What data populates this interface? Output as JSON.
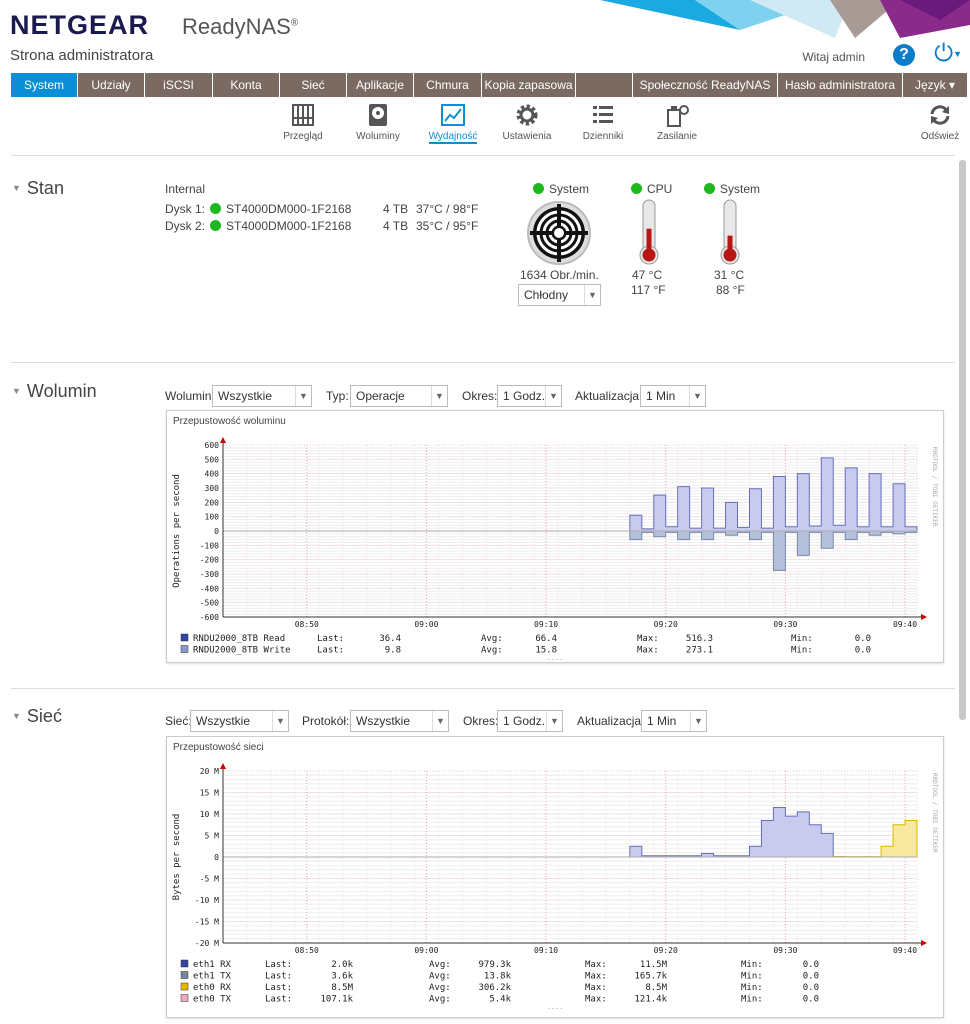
{
  "header": {
    "brand": "NETGEAR",
    "product": "ReadyNAS",
    "product_mark": "®",
    "subtitle": "Strona administratora",
    "welcome": "Witaj admin",
    "help_glyph": "?",
    "power_glyph": "⏻",
    "icons": [
      "help-icon",
      "power-icon"
    ]
  },
  "nav": [
    {
      "label": "System",
      "active": true
    },
    {
      "label": "Udziały"
    },
    {
      "label": "iSCSI"
    },
    {
      "label": "Konta"
    },
    {
      "label": "Sieć"
    },
    {
      "label": "Aplikacje"
    },
    {
      "label": "Chmura"
    },
    {
      "label": "Kopia zapasowa"
    },
    {
      "label": ""
    },
    {
      "label": "Społeczność ReadyNAS"
    },
    {
      "label": "Hasło administratora"
    },
    {
      "label": "Język ▾"
    }
  ],
  "toolbar": {
    "overview": "Przegląd",
    "volumes": "Woluminy",
    "performance": "Wydajność",
    "settings": "Ustawienia",
    "logs": "Dzienniki",
    "power": "Zasilanie",
    "refresh": "Odśwież"
  },
  "stan": {
    "title": "Stan",
    "group": "Internal",
    "disks": [
      {
        "label": "Dysk 1:",
        "model": "ST4000DM000-1F2168",
        "size": "4 TB",
        "temp": "37°C / 98°F"
      },
      {
        "label": "Dysk 2:",
        "model": "ST4000DM000-1F2168",
        "size": "4 TB",
        "temp": "35°C / 95°F"
      }
    ],
    "fan": {
      "label": "System",
      "rpm": "1634 Obr./min.",
      "mode": "Chłodny"
    },
    "cpu": {
      "label": "CPU",
      "c": "47 °C",
      "f": "117 °F",
      "level": 0.55
    },
    "sys": {
      "label": "System",
      "c": "31 °C",
      "f": "88 °F",
      "level": 0.4
    }
  },
  "wolumin": {
    "title": "Wolumin",
    "filters": {
      "volume_label": "Wolumin:",
      "volume": "Wszystkie",
      "type_label": "Typ:",
      "type": "Operacje",
      "period_label": "Okres:",
      "period": "1 Godz.",
      "update_label": "Aktualizacja:",
      "update": "1 Min"
    },
    "legend": [
      {
        "name": "RNDU2000_8TB Read",
        "color": "#3344aa",
        "last": "36.4",
        "avg": "66.4",
        "max": "516.3",
        "min": "0.0"
      },
      {
        "name": "RNDU2000_8TB Write",
        "color": "#8899cc",
        "last": "9.8",
        "avg": "15.8",
        "max": "273.1",
        "min": "0.0"
      }
    ]
  },
  "siec": {
    "title": "Sieć",
    "filters": {
      "net_label": "Sieć:",
      "net": "Wszystkie",
      "proto_label": "Protokół:",
      "proto": "Wszystkie",
      "period_label": "Okres:",
      "period": "1 Godz.",
      "update_label": "Aktualizacja:",
      "update": "1 Min"
    },
    "legend": [
      {
        "name": "eth1 RX",
        "color": "#3344aa",
        "last": "2.0k",
        "avg": "979.3k",
        "max": "11.5M",
        "min": "0.0"
      },
      {
        "name": "eth1 TX",
        "color": "#778899",
        "last": "3.6k",
        "avg": "13.8k",
        "max": "165.7k",
        "min": "0.0"
      },
      {
        "name": "eth0 RX",
        "color": "#e8b800",
        "last": "8.5M",
        "avg": "306.2k",
        "max": "8.5M",
        "min": "0.0"
      },
      {
        "name": "eth0 TX",
        "color": "#f2a8c0",
        "last": "107.1k",
        "avg": "5.4k",
        "max": "121.4k",
        "min": "0.0"
      }
    ]
  },
  "legend_labels": {
    "last": "Last:",
    "avg": "Avg:",
    "max": "Max:",
    "min": "Min:"
  },
  "chart_data": [
    {
      "type": "bar",
      "title": "Przepustowość woluminu",
      "ylabel": "Operations per second",
      "xlabel": "",
      "watermark": "RRDTOOL / TOBI OETIKER",
      "ylim": [
        -600,
        600
      ],
      "yticks": [
        "600",
        "500",
        "400",
        "300",
        "200",
        "100",
        "0",
        "-100",
        "-200",
        "-300",
        "-400",
        "-500",
        "-600"
      ],
      "xticks": [
        {
          "t": 50,
          "label": "08:50"
        },
        {
          "t": 60,
          "label": "09:00"
        },
        {
          "t": 70,
          "label": "09:10"
        },
        {
          "t": 80,
          "label": "09:20"
        },
        {
          "t": 90,
          "label": "09:30"
        },
        {
          "t": 100,
          "label": "09:40"
        }
      ],
      "x_range": [
        43,
        101
      ],
      "series": [
        {
          "name": "RNDU2000_8TB Read",
          "x": [
            77,
            78,
            79,
            80,
            81,
            82,
            83,
            84,
            85,
            86,
            87,
            88,
            89,
            90,
            91,
            92,
            93,
            94,
            95,
            96,
            97,
            98,
            99,
            100
          ],
          "values": [
            110,
            15,
            250,
            30,
            310,
            20,
            300,
            20,
            200,
            25,
            295,
            20,
            380,
            30,
            400,
            35,
            510,
            40,
            440,
            30,
            400,
            30,
            330,
            30
          ]
        },
        {
          "name": "RNDU2000_8TB Write",
          "x": [
            77,
            78,
            79,
            80,
            81,
            82,
            83,
            84,
            85,
            86,
            87,
            88,
            89,
            90,
            91,
            92,
            93,
            94,
            95,
            96,
            97,
            98,
            99,
            100
          ],
          "values": [
            -60,
            -10,
            -40,
            -10,
            -60,
            -10,
            -60,
            -10,
            -30,
            -10,
            -60,
            -10,
            -275,
            -10,
            -170,
            -10,
            -120,
            -10,
            -60,
            -10,
            -30,
            -10,
            -20,
            -10
          ]
        }
      ]
    },
    {
      "type": "area",
      "title": "Przepustowość sieci",
      "ylabel": "Bytes per second",
      "xlabel": "",
      "watermark": "RRDTOOL / TOBI OETIKER",
      "ylim": [
        -20,
        20
      ],
      "yticks": [
        "20 M",
        "15 M",
        "10 M",
        "5 M",
        "0",
        "-5 M",
        "-10 M",
        "-15 M",
        "-20 M"
      ],
      "xticks": [
        {
          "t": 50,
          "label": "08:50"
        },
        {
          "t": 60,
          "label": "09:00"
        },
        {
          "t": 70,
          "label": "09:10"
        },
        {
          "t": 80,
          "label": "09:20"
        },
        {
          "t": 90,
          "label": "09:30"
        },
        {
          "t": 100,
          "label": "09:40"
        }
      ],
      "x_range": [
        43,
        101
      ],
      "series": [
        {
          "name": "eth1 RX",
          "x": [
            77,
            78,
            79,
            80,
            81,
            82,
            83,
            84,
            85,
            86,
            87,
            88,
            89,
            90,
            91,
            92,
            93,
            94
          ],
          "values": [
            2.5,
            0.3,
            0.3,
            0.3,
            0.3,
            0.3,
            0.8,
            0.3,
            0.3,
            0.3,
            2.5,
            8.5,
            11.5,
            9.5,
            10.5,
            7.5,
            5.5,
            0.1
          ]
        },
        {
          "name": "eth0 RX",
          "x": [
            94,
            95,
            96,
            97,
            98,
            99,
            100
          ],
          "values": [
            0.1,
            0.1,
            0.1,
            0.1,
            2.5,
            7.5,
            8.5
          ]
        }
      ]
    }
  ]
}
